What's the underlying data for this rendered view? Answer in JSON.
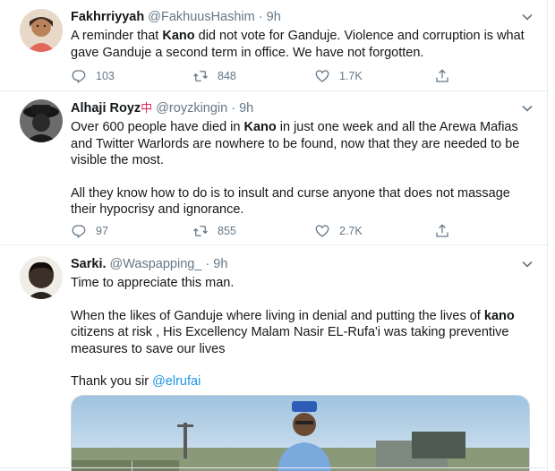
{
  "tweets": [
    {
      "name": "Fakhrriyyah",
      "handle": "@FakhuusHashim",
      "time": "9h",
      "text_segments": [
        {
          "t": "A reminder that ",
          "b": false
        },
        {
          "t": "Kano",
          "b": true
        },
        {
          "t": " did not vote for Ganduje. Violence and corruption is what gave Ganduje a second term in office. We have not forgotten.",
          "b": false
        }
      ],
      "replies": "103",
      "retweets": "848",
      "likes": "1.7K"
    },
    {
      "name": "Alhaji Royz",
      "name_badge": "中",
      "handle": "@royzkingin",
      "time": "9h",
      "para1_segments": [
        {
          "t": "Over 600 people have died in ",
          "b": false
        },
        {
          "t": "Kano",
          "b": true
        },
        {
          "t": " in just one week and all the Arewa Mafias and Twitter Warlords are nowhere to be found, now that they are needed to be visible the most.",
          "b": false
        }
      ],
      "para2": "All they know how to do is to insult and curse anyone that does not massage their hypocrisy and ignorance.",
      "replies": "97",
      "retweets": "855",
      "likes": "2.7K"
    },
    {
      "name": "Sarki.",
      "handle": "@Waspapping_",
      "time": "9h",
      "para1": "Time to appreciate this man.",
      "para2_segments": [
        {
          "t": "When the likes of Ganduje where living in denial and putting the lives of ",
          "b": false
        },
        {
          "t": "kano",
          "b": true
        },
        {
          "t": " citizens at risk , His Excellency Malam Nasir EL-Rufa'i was taking preventive measures to save our lives",
          "b": false
        }
      ],
      "para3_prefix": "Thank you sir ",
      "para3_mention": "@elrufai"
    }
  ],
  "separator": "·",
  "icons": {
    "reply": "reply-icon",
    "retweet": "retweet-icon",
    "like": "heart-icon",
    "share": "share-icon",
    "more": "chevron-down-icon"
  },
  "colors": {
    "text": "#14171a",
    "secondary": "#657786",
    "link": "#1b95e0",
    "border": "#e6ecf0"
  }
}
